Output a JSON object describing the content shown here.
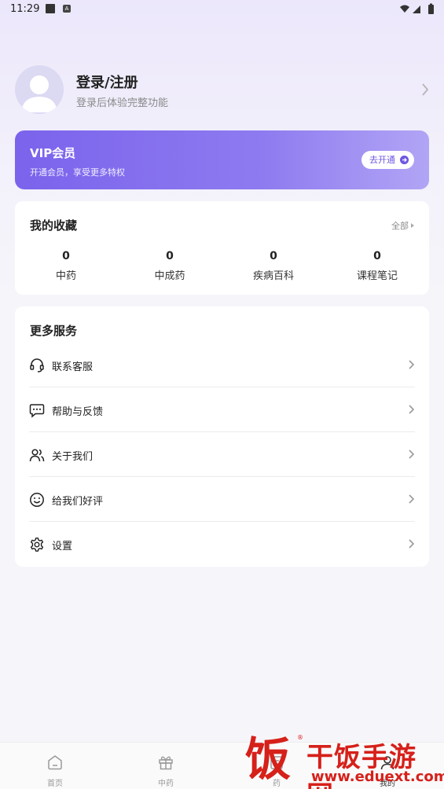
{
  "status_bar": {
    "time": "11:29"
  },
  "profile": {
    "title": "登录/注册",
    "subtitle": "登录后体验完整功能"
  },
  "vip": {
    "title": "VIP会员",
    "subtitle": "开通会员，享受更多特权",
    "button": "去开通"
  },
  "favorites": {
    "title": "我的收藏",
    "all": "全部",
    "items": [
      {
        "count": "0",
        "label": "中药"
      },
      {
        "count": "0",
        "label": "中成药"
      },
      {
        "count": "0",
        "label": "疾病百科"
      },
      {
        "count": "0",
        "label": "课程笔记"
      }
    ]
  },
  "services": {
    "title": "更多服务",
    "items": [
      {
        "label": "联系客服",
        "icon": "headset-icon"
      },
      {
        "label": "帮助与反馈",
        "icon": "chat-bubble-icon"
      },
      {
        "label": "关于我们",
        "icon": "users-icon"
      },
      {
        "label": "给我们好评",
        "icon": "smile-icon"
      },
      {
        "label": "设置",
        "icon": "gear-icon"
      }
    ]
  },
  "tabbar": {
    "items": [
      {
        "label": "首页",
        "icon": "home-icon"
      },
      {
        "label": "中药",
        "icon": "gift-icon"
      },
      {
        "label": "药",
        "icon": "medicine-icon"
      },
      {
        "label": "我的",
        "icon": "user-icon"
      }
    ]
  },
  "watermark": {
    "char": "饭",
    "title": "干饭手游网",
    "url": "www.eduext.com"
  },
  "colors": {
    "accent": "#7b63ec",
    "watermark": "#d6201a"
  }
}
